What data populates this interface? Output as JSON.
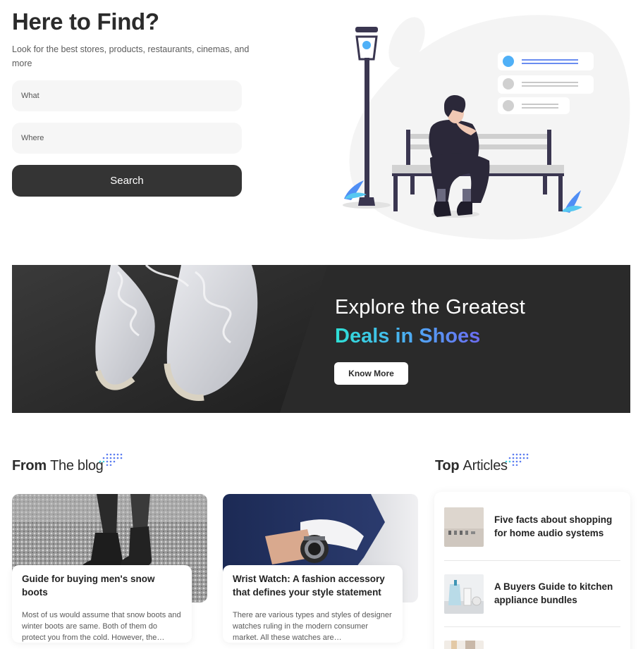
{
  "hero": {
    "title": "Here to Find?",
    "subtitle": "Look for the best stores, products, restaurants, cinemas, and more",
    "what_placeholder": "What",
    "where_placeholder": "Where",
    "search_label": "Search"
  },
  "banner": {
    "line1": "Explore the Greatest",
    "line2": "Deals in Shoes",
    "button_label": "Know More",
    "gradient_colors": [
      "#2ee0d6",
      "#4fa8f5",
      "#6b6bf0"
    ]
  },
  "blog": {
    "heading_bold": "From",
    "heading_light": "The blog",
    "posts": [
      {
        "title": "Guide for buying men's snow boots",
        "excerpt": "Most of us would assume that snow boots and winter boots are same. Both of them do protect you from the cold. However, the…"
      },
      {
        "title": "Wrist Watch: A fashion accessory that defines your style statement",
        "excerpt": "There are various types and styles of designer watches ruling in the modern consumer market. All these watches are…"
      }
    ]
  },
  "top_articles": {
    "heading_bold": "Top",
    "heading_light": "Articles",
    "items": [
      {
        "title": "Five facts about shopping for home audio systems"
      },
      {
        "title": "A Buyers Guide to kitchen appliance bundles"
      },
      {
        "title": ""
      }
    ]
  },
  "colors": {
    "accent_gradient_start": "#2ee0d6",
    "accent_gradient_end": "#6b6bf0",
    "dark_button": "#343434"
  }
}
